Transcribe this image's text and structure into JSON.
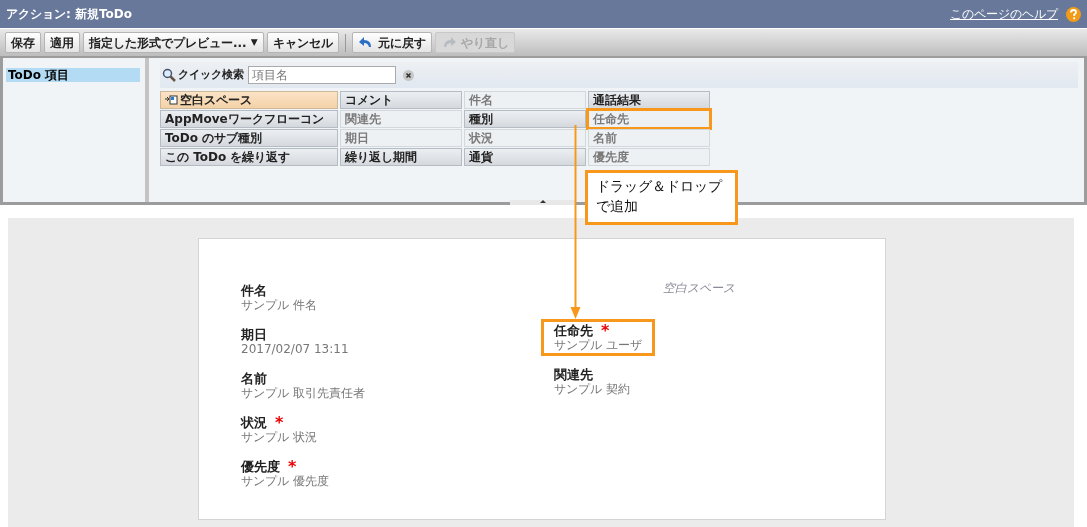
{
  "window": {
    "title": "アクション: 新規ToDo",
    "help_link": "このページのヘルプ"
  },
  "toolbar": [
    {
      "kind": "button",
      "label": "保存",
      "disabled": false
    },
    {
      "kind": "button",
      "label": "適用",
      "disabled": false
    },
    {
      "kind": "dropdown",
      "label": "指定した形式でプレビュー...",
      "caret": "▼",
      "disabled": false
    },
    {
      "kind": "button",
      "label": "キャンセル",
      "disabled": false
    },
    {
      "kind": "undo",
      "label": "元に戻す",
      "disabled": false
    },
    {
      "kind": "redo",
      "label": "やり直し",
      "disabled": true
    }
  ],
  "sidebar": {
    "items": [
      {
        "label": "ToDo 項目",
        "selected": true
      }
    ]
  },
  "quick_search": {
    "label": "クイック検索",
    "placeholder": "項目名"
  },
  "palette": [
    {
      "label": "空白スペース",
      "kind": "blank",
      "used": false,
      "highlighted": false
    },
    {
      "label": "コメント",
      "kind": "field",
      "used": false,
      "highlighted": false
    },
    {
      "label": "件名",
      "kind": "field",
      "used": true,
      "highlighted": false
    },
    {
      "label": "通話結果",
      "kind": "field",
      "used": false,
      "highlighted": false
    },
    {
      "label": "AppMoveワークフローコン",
      "kind": "field",
      "used": false,
      "highlighted": false
    },
    {
      "label": "関連先",
      "kind": "field",
      "used": true,
      "highlighted": false
    },
    {
      "label": "種別",
      "kind": "field",
      "used": false,
      "highlighted": false
    },
    {
      "label": "任命先",
      "kind": "field",
      "used": true,
      "highlighted": true
    },
    {
      "label": "ToDo のサブ種別",
      "kind": "field",
      "used": false,
      "highlighted": false
    },
    {
      "label": "期日",
      "kind": "field",
      "used": true,
      "highlighted": false
    },
    {
      "label": "状況",
      "kind": "field",
      "used": true,
      "highlighted": false
    },
    {
      "label": "名前",
      "kind": "field",
      "used": true,
      "highlighted": false
    },
    {
      "label": "この ToDo を繰り返す",
      "kind": "field",
      "used": false,
      "highlighted": false
    },
    {
      "label": "繰り返し期間",
      "kind": "field",
      "used": false,
      "highlighted": false
    },
    {
      "label": "通貨",
      "kind": "field",
      "used": false,
      "highlighted": false
    },
    {
      "label": "優先度",
      "kind": "field",
      "used": true,
      "highlighted": false
    }
  ],
  "callout": "ドラッグ＆ドロップで追加",
  "layout": {
    "left": [
      {
        "kind": "field",
        "label": "件名",
        "value": "サンプル 件名",
        "highlighted": false
      },
      {
        "kind": "field",
        "label": "期日",
        "value": "2017/02/07 13:11",
        "highlighted": false
      },
      {
        "kind": "field",
        "label": "名前",
        "value": "サンプル 取引先責任者",
        "highlighted": false
      },
      {
        "kind": "field",
        "label": "状況",
        "value": "サンプル 状況",
        "required_mark": "*",
        "highlighted": false
      },
      {
        "kind": "field",
        "label": "優先度",
        "value": "サンプル 優先度",
        "required_mark": "*",
        "highlighted": false
      }
    ],
    "right": [
      {
        "kind": "blank",
        "label": "空白スペース"
      },
      {
        "kind": "field",
        "label": "任命先",
        "value": "サンプル ユーザ",
        "required_mark": "*",
        "highlighted": true
      },
      {
        "kind": "field",
        "label": "関連先",
        "value": "サンプル 契約",
        "highlighted": false
      }
    ]
  }
}
